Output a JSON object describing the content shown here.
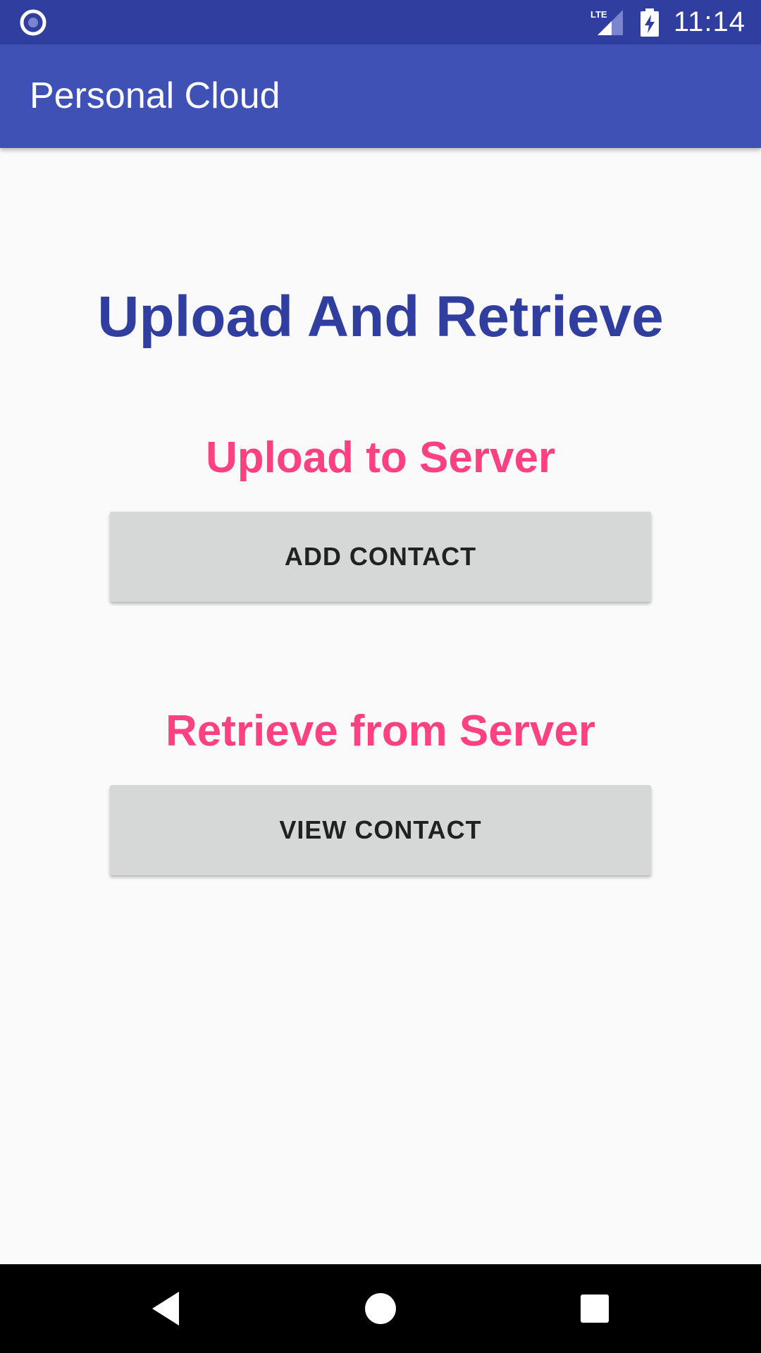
{
  "status_bar": {
    "time": "11:14",
    "network_label": "LTE",
    "icons": [
      "radio-icon",
      "lte-signal-icon",
      "battery-charging-icon"
    ]
  },
  "app_bar": {
    "title": "Personal Cloud"
  },
  "main": {
    "heading": "Upload And Retrieve",
    "upload_section": {
      "heading": "Upload to Server",
      "button_label": "ADD CONTACT"
    },
    "retrieve_section": {
      "heading": "Retrieve from Server",
      "button_label": "VIEW CONTACT"
    }
  },
  "nav_bar": {
    "icons": [
      "back-icon",
      "home-icon",
      "recents-icon"
    ]
  },
  "colors": {
    "status_bar": "#303f9f",
    "app_bar": "#3f51b5",
    "heading": "#303f9f",
    "accent": "#ff4081",
    "button": "#d6d7d7",
    "background": "#fafafa"
  }
}
